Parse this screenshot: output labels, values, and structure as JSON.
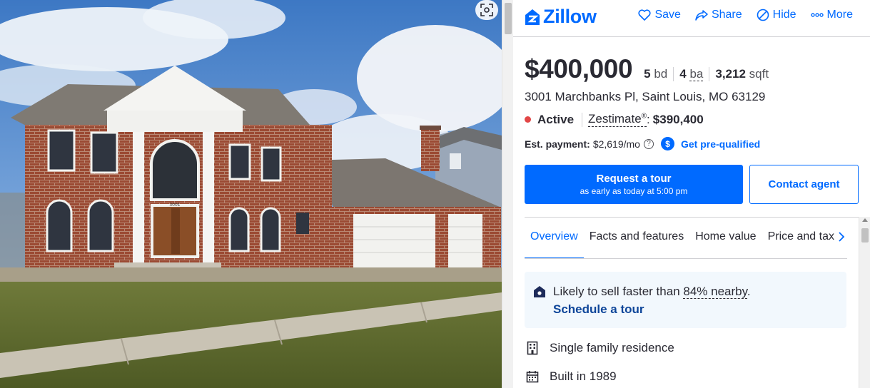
{
  "header": {
    "logo_text": "Zillow",
    "actions": [
      {
        "label": "Save",
        "icon": "heart-icon"
      },
      {
        "label": "Share",
        "icon": "share-icon"
      },
      {
        "label": "Hide",
        "icon": "hide-icon"
      },
      {
        "label": "More",
        "icon": "more-icon"
      }
    ]
  },
  "photo": {
    "house_number": "3001"
  },
  "listing": {
    "price": "$400,000",
    "beds_value": "5",
    "beds_unit": "bd",
    "baths_value": "4",
    "baths_unit": "ba",
    "sqft_value": "3,212",
    "sqft_unit": "sqft",
    "address": "3001 Marchbanks Pl, Saint Louis, MO 63129",
    "status": "Active",
    "status_color": "#e24646",
    "zestimate_label": "Zestimate",
    "zestimate_sup": "®",
    "zestimate_colon": ":",
    "zestimate_value": "$390,400",
    "payment_label": "Est. payment:",
    "payment_value": "$2,619/mo",
    "payment_help": "?",
    "prequal_icon_text": "$",
    "prequal_label": "Get pre-qualified"
  },
  "buttons": {
    "tour_line1": "Request a tour",
    "tour_line2": "as early as today at 5:00 pm",
    "contact": "Contact agent"
  },
  "tabs": [
    {
      "label": "Overview",
      "active": true
    },
    {
      "label": "Facts and features",
      "active": false
    },
    {
      "label": "Home value",
      "active": false
    },
    {
      "label": "Price and tax history",
      "active": false
    }
  ],
  "highlight": {
    "text_before": "Likely to sell faster than ",
    "percent": "84% nearby",
    "text_after": ".",
    "link": "Schedule a tour"
  },
  "features": [
    {
      "label": "Single family residence",
      "icon": "building-icon"
    },
    {
      "label": "Built in 1989",
      "icon": "calendar-icon"
    }
  ],
  "colors": {
    "brand_blue": "#006aff",
    "link_dark_blue": "#0d4599",
    "text": "#2a2a33",
    "highlight_bg": "#f2f8fd"
  }
}
